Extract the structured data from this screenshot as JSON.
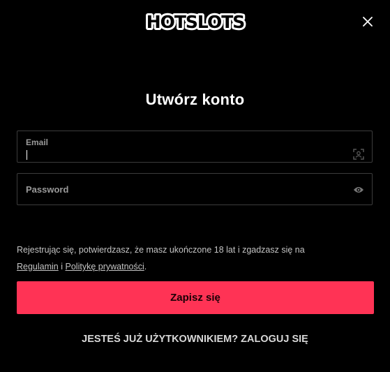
{
  "logo": {
    "text": "HOTSLOTS"
  },
  "header": {
    "title": "Utwórz konto"
  },
  "email": {
    "label": "Email",
    "value": ""
  },
  "password": {
    "placeholder": "Password"
  },
  "terms": {
    "prefix": "Rejestrując się, potwierdzasz, że masz ukończone 18 lat i zgadzasz się na",
    "regulamin": "Regulamin",
    "conj": "i",
    "policy": "Politykę prywatności",
    "suffix": "."
  },
  "submit": {
    "label": "Zapisz się"
  },
  "login": {
    "label": "JESTEŚ JUŻ UŻYTKOWNIKIEM? ZALOGUJ SIĘ"
  },
  "icons": {
    "close": "close-icon",
    "email_field": "autofill-icon",
    "password_field": "eye-icon"
  },
  "colors": {
    "background": "#000000",
    "accent": "#ff3355",
    "border": "#3c3c3c",
    "muted_text": "#9a9a9a"
  }
}
